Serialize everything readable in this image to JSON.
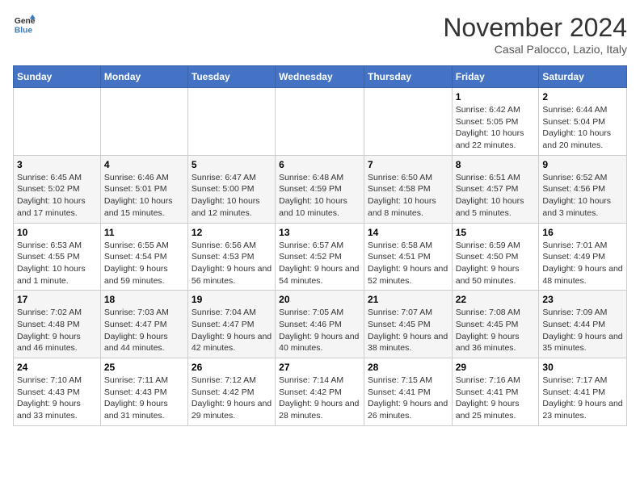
{
  "header": {
    "logo_line1": "General",
    "logo_line2": "Blue",
    "title": "November 2024",
    "subtitle": "Casal Palocco, Lazio, Italy"
  },
  "weekdays": [
    "Sunday",
    "Monday",
    "Tuesday",
    "Wednesday",
    "Thursday",
    "Friday",
    "Saturday"
  ],
  "weeks": [
    [
      {
        "day": "",
        "info": ""
      },
      {
        "day": "",
        "info": ""
      },
      {
        "day": "",
        "info": ""
      },
      {
        "day": "",
        "info": ""
      },
      {
        "day": "",
        "info": ""
      },
      {
        "day": "1",
        "info": "Sunrise: 6:42 AM\nSunset: 5:05 PM\nDaylight: 10 hours and 22 minutes."
      },
      {
        "day": "2",
        "info": "Sunrise: 6:44 AM\nSunset: 5:04 PM\nDaylight: 10 hours and 20 minutes."
      }
    ],
    [
      {
        "day": "3",
        "info": "Sunrise: 6:45 AM\nSunset: 5:02 PM\nDaylight: 10 hours and 17 minutes."
      },
      {
        "day": "4",
        "info": "Sunrise: 6:46 AM\nSunset: 5:01 PM\nDaylight: 10 hours and 15 minutes."
      },
      {
        "day": "5",
        "info": "Sunrise: 6:47 AM\nSunset: 5:00 PM\nDaylight: 10 hours and 12 minutes."
      },
      {
        "day": "6",
        "info": "Sunrise: 6:48 AM\nSunset: 4:59 PM\nDaylight: 10 hours and 10 minutes."
      },
      {
        "day": "7",
        "info": "Sunrise: 6:50 AM\nSunset: 4:58 PM\nDaylight: 10 hours and 8 minutes."
      },
      {
        "day": "8",
        "info": "Sunrise: 6:51 AM\nSunset: 4:57 PM\nDaylight: 10 hours and 5 minutes."
      },
      {
        "day": "9",
        "info": "Sunrise: 6:52 AM\nSunset: 4:56 PM\nDaylight: 10 hours and 3 minutes."
      }
    ],
    [
      {
        "day": "10",
        "info": "Sunrise: 6:53 AM\nSunset: 4:55 PM\nDaylight: 10 hours and 1 minute."
      },
      {
        "day": "11",
        "info": "Sunrise: 6:55 AM\nSunset: 4:54 PM\nDaylight: 9 hours and 59 minutes."
      },
      {
        "day": "12",
        "info": "Sunrise: 6:56 AM\nSunset: 4:53 PM\nDaylight: 9 hours and 56 minutes."
      },
      {
        "day": "13",
        "info": "Sunrise: 6:57 AM\nSunset: 4:52 PM\nDaylight: 9 hours and 54 minutes."
      },
      {
        "day": "14",
        "info": "Sunrise: 6:58 AM\nSunset: 4:51 PM\nDaylight: 9 hours and 52 minutes."
      },
      {
        "day": "15",
        "info": "Sunrise: 6:59 AM\nSunset: 4:50 PM\nDaylight: 9 hours and 50 minutes."
      },
      {
        "day": "16",
        "info": "Sunrise: 7:01 AM\nSunset: 4:49 PM\nDaylight: 9 hours and 48 minutes."
      }
    ],
    [
      {
        "day": "17",
        "info": "Sunrise: 7:02 AM\nSunset: 4:48 PM\nDaylight: 9 hours and 46 minutes."
      },
      {
        "day": "18",
        "info": "Sunrise: 7:03 AM\nSunset: 4:47 PM\nDaylight: 9 hours and 44 minutes."
      },
      {
        "day": "19",
        "info": "Sunrise: 7:04 AM\nSunset: 4:47 PM\nDaylight: 9 hours and 42 minutes."
      },
      {
        "day": "20",
        "info": "Sunrise: 7:05 AM\nSunset: 4:46 PM\nDaylight: 9 hours and 40 minutes."
      },
      {
        "day": "21",
        "info": "Sunrise: 7:07 AM\nSunset: 4:45 PM\nDaylight: 9 hours and 38 minutes."
      },
      {
        "day": "22",
        "info": "Sunrise: 7:08 AM\nSunset: 4:45 PM\nDaylight: 9 hours and 36 minutes."
      },
      {
        "day": "23",
        "info": "Sunrise: 7:09 AM\nSunset: 4:44 PM\nDaylight: 9 hours and 35 minutes."
      }
    ],
    [
      {
        "day": "24",
        "info": "Sunrise: 7:10 AM\nSunset: 4:43 PM\nDaylight: 9 hours and 33 minutes."
      },
      {
        "day": "25",
        "info": "Sunrise: 7:11 AM\nSunset: 4:43 PM\nDaylight: 9 hours and 31 minutes."
      },
      {
        "day": "26",
        "info": "Sunrise: 7:12 AM\nSunset: 4:42 PM\nDaylight: 9 hours and 29 minutes."
      },
      {
        "day": "27",
        "info": "Sunrise: 7:14 AM\nSunset: 4:42 PM\nDaylight: 9 hours and 28 minutes."
      },
      {
        "day": "28",
        "info": "Sunrise: 7:15 AM\nSunset: 4:41 PM\nDaylight: 9 hours and 26 minutes."
      },
      {
        "day": "29",
        "info": "Sunrise: 7:16 AM\nSunset: 4:41 PM\nDaylight: 9 hours and 25 minutes."
      },
      {
        "day": "30",
        "info": "Sunrise: 7:17 AM\nSunset: 4:41 PM\nDaylight: 9 hours and 23 minutes."
      }
    ]
  ]
}
